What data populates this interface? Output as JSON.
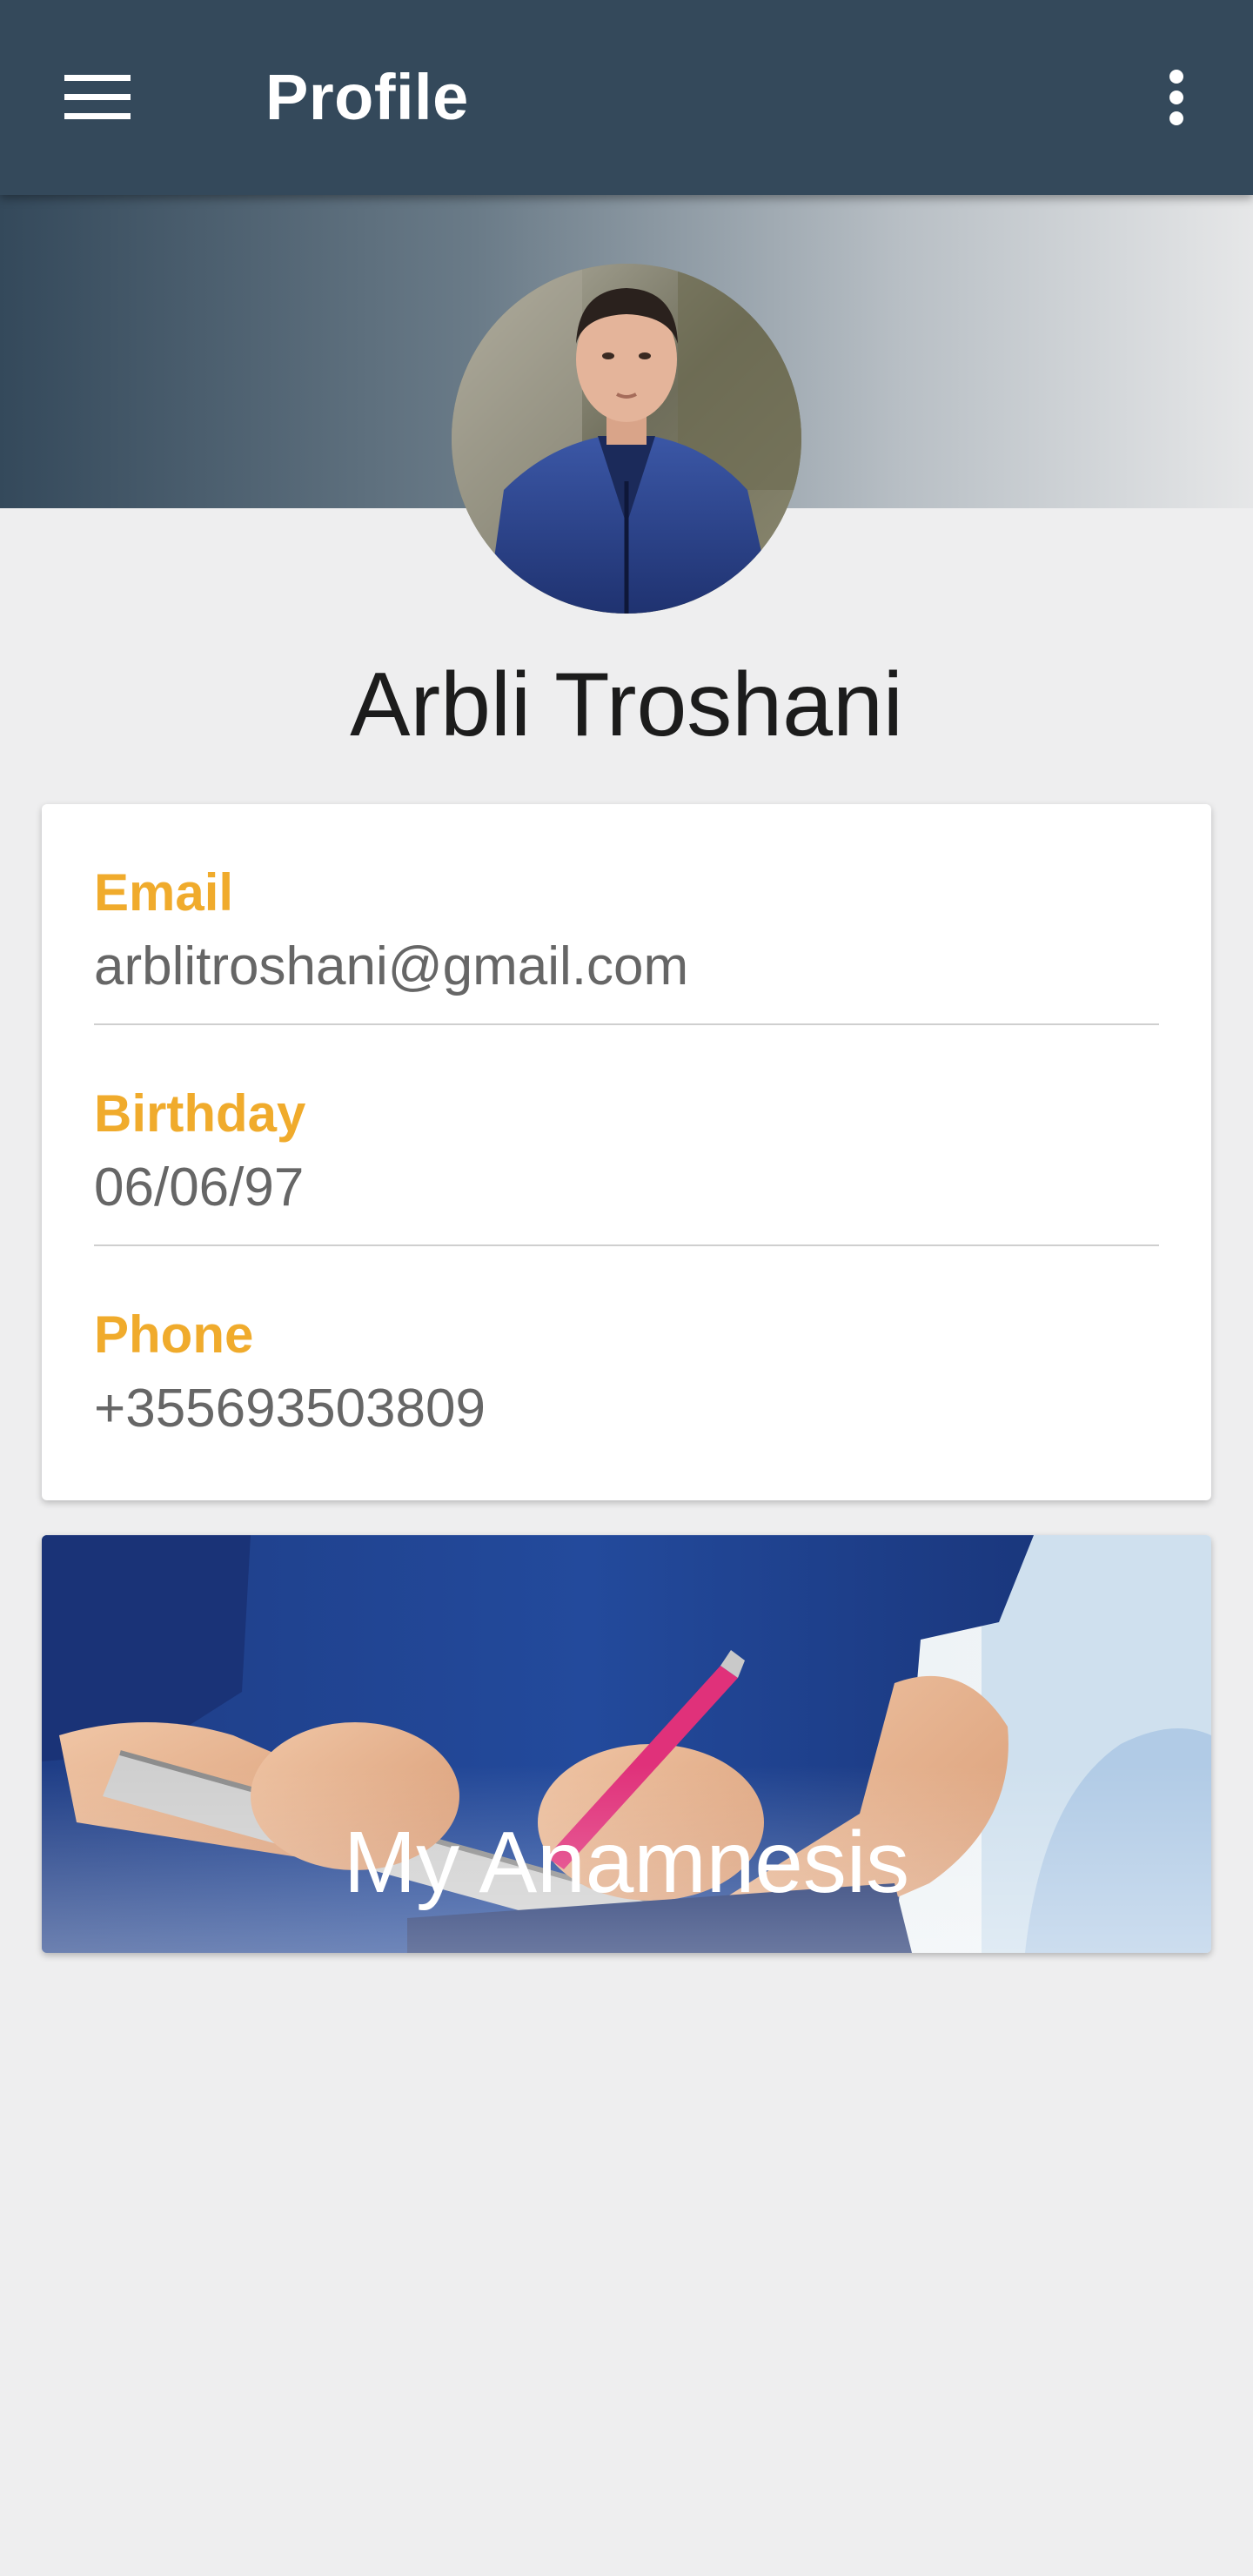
{
  "toolbar": {
    "title": "Profile",
    "menu_icon": "hamburger-menu-icon",
    "overflow_icon": "more-vertical-icon"
  },
  "profile": {
    "name": "Arbli Troshani"
  },
  "details": {
    "email_label": "Email",
    "email_value": "arblitroshani@gmail.com",
    "birthday_label": "Birthday",
    "birthday_value": "06/06/97",
    "phone_label": "Phone",
    "phone_value": "+355693503809"
  },
  "anamnesis": {
    "label": "My Anamnesis"
  },
  "colors": {
    "toolbar": "#34495b",
    "accent_label": "#f0ab2c",
    "value_text": "#666666",
    "background": "#eeeeef"
  }
}
